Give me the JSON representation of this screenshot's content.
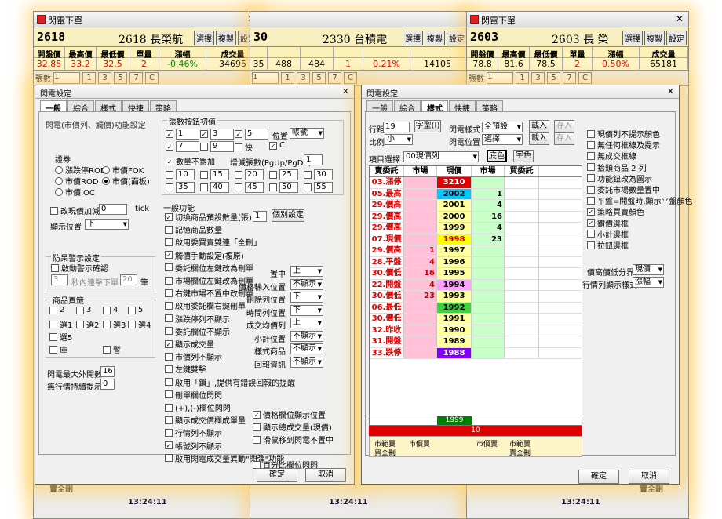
{
  "windows": [
    {
      "title": "閃電下單",
      "code": "2618",
      "name": "2618 長榮航",
      "buttons": [
        "選擇",
        "複製",
        "設定"
      ],
      "headers": [
        "開盤價",
        "最高價",
        "最低價",
        "單量",
        "漲幅",
        "成交量"
      ],
      "values": [
        "32.85",
        "33.2",
        "32.5",
        "2",
        "-0.46%",
        "34695"
      ],
      "stepper_label": "張數",
      "stepper_value": "1",
      "steps": [
        "1",
        "3",
        "5",
        "7",
        "C"
      ]
    },
    {
      "title": "",
      "code": "30",
      "name": "2330 台積電",
      "buttons": [
        "選擇",
        "複製",
        "設定"
      ],
      "values": [
        "35",
        "488",
        "484",
        "1",
        "0.21%",
        "14105"
      ],
      "stepper_value": "1",
      "steps": [
        "1",
        "3",
        "5",
        "7",
        "C"
      ]
    },
    {
      "title": "閃電下單",
      "code": "2603",
      "name": "2603 長 榮",
      "buttons": [
        "選擇",
        "複製",
        "設定"
      ],
      "headers": [
        "開盤價",
        "最高價",
        "最低價",
        "單量",
        "漲幅",
        "成交量"
      ],
      "values": [
        "78.8",
        "81.6",
        "78.5",
        "2",
        "0.50%",
        "65181"
      ],
      "stepper_label": "張數",
      "stepper_value": "1",
      "steps": [
        "1",
        "3",
        "5",
        "7",
        "C"
      ]
    }
  ],
  "footer": {
    "balance_label": "賣全刪",
    "time": "13:24:11"
  },
  "dialog1": {
    "title": "閃電設定",
    "tabs": [
      "一般",
      "綜合",
      "樣式",
      "快捷",
      "策略"
    ],
    "func_heading": "閃電(市價列、觸價)功能設定",
    "securities_label": "證券",
    "radios": [
      "漲跌停ROD",
      "市價FOK",
      "市價ROD",
      "市價(面板)",
      "市價IOC"
    ],
    "change_price": "改現價加減",
    "change_value": "0",
    "tick": "tick",
    "display_pos_label": "顯示位置",
    "display_pos_value": "下",
    "antierr": {
      "title": "防呆警示設定",
      "confirm": "啟動警示確認",
      "v1": "3",
      "mid": "秒內連擊下單",
      "v2": "20",
      "unit": "筆"
    },
    "pages": {
      "title": "商品頁籤",
      "items": [
        "2",
        "3",
        "4",
        "5",
        "選1",
        "選2",
        "選3",
        "選4",
        "選5",
        "庫",
        "暫"
      ]
    },
    "max_open_label": "閃電最大外開數",
    "max_open_value": "16",
    "row_hint_label": "無行情持續提示",
    "row_hint_value": "0",
    "qty_init_title": "張數按鈕初值",
    "qty": [
      {
        "c": "✓",
        "v": "1"
      },
      {
        "c": "✓",
        "v": "3"
      },
      {
        "c": "✓",
        "v": "5"
      },
      {
        "c": "✓",
        "v": "7"
      },
      {
        "c": "",
        "v": "9"
      },
      {
        "c": "",
        "v": "快"
      },
      {
        "c": "✓",
        "v": "C"
      }
    ],
    "pos_label": "位置",
    "pos_value": "帳號",
    "qty_nochange": "數量不累加",
    "inc_label": "增減張數(PgUp/PgDn)",
    "inc_value": "1",
    "more_qty": [
      "10",
      "15",
      "20",
      "25",
      "30",
      "35",
      "40",
      "45",
      "50",
      "55"
    ],
    "general_title": "一般功能",
    "general": [
      {
        "c": "✓",
        "t": "切換商品預設數量(張)"
      },
      {
        "c": "",
        "t": "記憶商品數量"
      },
      {
        "c": "",
        "t": "啟用委買賣雙連「全刪」"
      },
      {
        "c": "✓",
        "t": "觸價手動設定(複原)"
      },
      {
        "c": "",
        "t": "委託欄位左鍵改為刪單"
      },
      {
        "c": "",
        "t": "市場欄位左鍵改為刪單"
      },
      {
        "c": "",
        "t": "右鍵市場不置中改刪單"
      },
      {
        "c": "",
        "t": "啟用委託欄右鍵刪單"
      },
      {
        "c": "",
        "t": "漲跌停列不顯示"
      },
      {
        "c": "",
        "t": "委託欄位不顯示"
      },
      {
        "c": "✓",
        "t": "顯示成交量"
      },
      {
        "c": "",
        "t": "市價列不顯示"
      },
      {
        "c": "",
        "t": "左鍵雙擊"
      },
      {
        "c": "",
        "t": "啟用「鎖」,提供有錯誤回報的提醒"
      },
      {
        "c": "",
        "t": "刪單欄位閃閃"
      },
      {
        "c": "",
        "t": "(+),(-)欄位閃閃"
      },
      {
        "c": "",
        "t": "顯示成交價欄成單量"
      },
      {
        "c": "",
        "t": "行情列不顯示"
      },
      {
        "c": "✓",
        "t": "帳號列不顯示"
      },
      {
        "c": "",
        "t": "啟用閃電成交量異動\"閃彈\"功能"
      }
    ],
    "default_qty_value": "1",
    "default_btn": "個別設定",
    "right_opts": [
      {
        "l": "置中",
        "v": "上"
      },
      {
        "l": "價格輸入位置",
        "v": "不顯示"
      },
      {
        "l": "刪除列位置",
        "v": "下"
      },
      {
        "l": "時間列位置",
        "v": "下"
      },
      {
        "l": "成交均價列",
        "v": "上"
      },
      {
        "l": "小計位置",
        "v": "不顯示"
      },
      {
        "l": "樣式商品",
        "v": "不顯示"
      },
      {
        "l": "回報資訊",
        "v": "不顯示"
      }
    ],
    "extra": [
      {
        "c": "✓",
        "t": "價格欄位顯示位置"
      },
      {
        "c": "",
        "t": "顯示總成交量(現價)"
      },
      {
        "c": "",
        "t": "滑鼠移到閃電不置中"
      },
      {
        "c": "",
        "t": "百分比欄位閃閃"
      }
    ],
    "ok": "確定",
    "cancel": "取消"
  },
  "dialog2": {
    "title": "閃電設定",
    "tabs": [
      "一般",
      "綜合",
      "樣式",
      "快捷",
      "策略"
    ],
    "row_height_label": "行距",
    "row_height_value": "19",
    "font_btn": "字型(I)",
    "style_label": "閃電樣式",
    "style_value": "全預設",
    "load": "載入",
    "save": "存入",
    "ratio_label": "比例",
    "ratio_value": "小",
    "pos_label": "閃電位置",
    "pos_value": "選擇",
    "item_label": "項目選擇",
    "item_value": "00現價列",
    "bg_btn": "底色",
    "fg_btn": "字色",
    "grid_headers": [
      "賣委託",
      "市場",
      "現價",
      "市場",
      "買委託"
    ],
    "rows": [
      {
        "lab": "03.漲停",
        "s": "",
        "m": "",
        "p": "3210",
        "pb": "#e00000",
        "pc": "#fff",
        "bm": "",
        "bc": ""
      },
      {
        "lab": "05.最高",
        "s": "",
        "m": "",
        "p": "2002",
        "pb": "#00c8ff",
        "pc": "#000",
        "bm": "1",
        "bc": ""
      },
      {
        "lab": "29.價高",
        "s": "",
        "m": "",
        "p": "2001",
        "pb": "#ffffa0",
        "pc": "#000",
        "bm": "4",
        "bc": ""
      },
      {
        "lab": "29.價高",
        "s": "",
        "m": "",
        "p": "2000",
        "pb": "#ffffa0",
        "pc": "#000",
        "bm": "16",
        "bc": ""
      },
      {
        "lab": "29.價高",
        "s": "",
        "m": "",
        "p": "1999",
        "pb": "#ffffa0",
        "pc": "#000",
        "bm": "4",
        "bc": ""
      },
      {
        "lab": "07.現價",
        "s": "",
        "m": "",
        "p": "1998",
        "pb": "#ffff00",
        "pc": "#c00",
        "bm": "23",
        "bc": ""
      },
      {
        "lab": "29.價高",
        "s": "",
        "m": "1",
        "p": "1997",
        "pb": "#ffffa0",
        "pc": "#000",
        "bm": "",
        "bc": ""
      },
      {
        "lab": "28.平盤",
        "s": "",
        "m": "4",
        "p": "1996",
        "pb": "#ffffa0",
        "pc": "#000",
        "bm": "",
        "bc": ""
      },
      {
        "lab": "30.價低",
        "s": "",
        "m": "16",
        "p": "1995",
        "pb": "#ffffa0",
        "pc": "#000",
        "bm": "",
        "bc": ""
      },
      {
        "lab": "22.開盤",
        "s": "",
        "m": "4",
        "p": "1994",
        "pb": "#ffa0ff",
        "pc": "#000",
        "bm": "",
        "bc": ""
      },
      {
        "lab": "30.價低",
        "s": "",
        "m": "23",
        "p": "1993",
        "pb": "#ffffa0",
        "pc": "#000",
        "bm": "",
        "bc": ""
      },
      {
        "lab": "06.最低",
        "s": "",
        "m": "",
        "p": "1992",
        "pb": "#40d040",
        "pc": "#000",
        "bm": "",
        "bc": ""
      },
      {
        "lab": "30.價低",
        "s": "",
        "m": "",
        "p": "1991",
        "pb": "#ffffa0",
        "pc": "#000",
        "bm": "",
        "bc": ""
      },
      {
        "lab": "32.昨收",
        "s": "",
        "m": "",
        "p": "1990",
        "pb": "#ffffa0",
        "pc": "#000",
        "bm": "",
        "bc": ""
      },
      {
        "lab": "31.開盤",
        "s": "",
        "m": "",
        "p": "1989",
        "pb": "#ffffa0",
        "pc": "#000",
        "bm": "",
        "bc": ""
      },
      {
        "lab": "33.跌停",
        "s": "",
        "m": "",
        "p": "1988",
        "pb": "#8000ff",
        "pc": "#fff",
        "bm": "",
        "bc": ""
      }
    ],
    "bottom_price": "1999",
    "bottom_qty": "10",
    "foot_left1": "市範買",
    "foot_left2": "市價買",
    "foot_right1": "市價賣",
    "foot_right2": "市範賣",
    "foot_left3": "買全刪",
    "foot_right3": "賣全刪",
    "options": [
      {
        "c": "",
        "t": "現價列不提示顏色"
      },
      {
        "c": "",
        "t": "無任何框線及提示"
      },
      {
        "c": "",
        "t": "無成交框線"
      },
      {
        "c": "",
        "t": "拾頭商品 2 列"
      },
      {
        "c": "",
        "t": "功能鈕改為圖示"
      },
      {
        "c": "",
        "t": "委託市場數量置中"
      },
      {
        "c": "",
        "t": "平盤=開盤時,顯示平盤顏色"
      },
      {
        "c": "✓",
        "t": "策略買賣顏色"
      },
      {
        "c": "✓",
        "t": "鑽價邊框"
      },
      {
        "c": "",
        "t": "小計邊框"
      },
      {
        "c": "",
        "t": "拉鈕邊框"
      }
    ],
    "hl_label": "價高價低分界",
    "hl_value": "現價",
    "row_style_label": "行情列顯示樣式",
    "row_style_value": "漲幅",
    "ok": "確定",
    "cancel": "取消"
  }
}
